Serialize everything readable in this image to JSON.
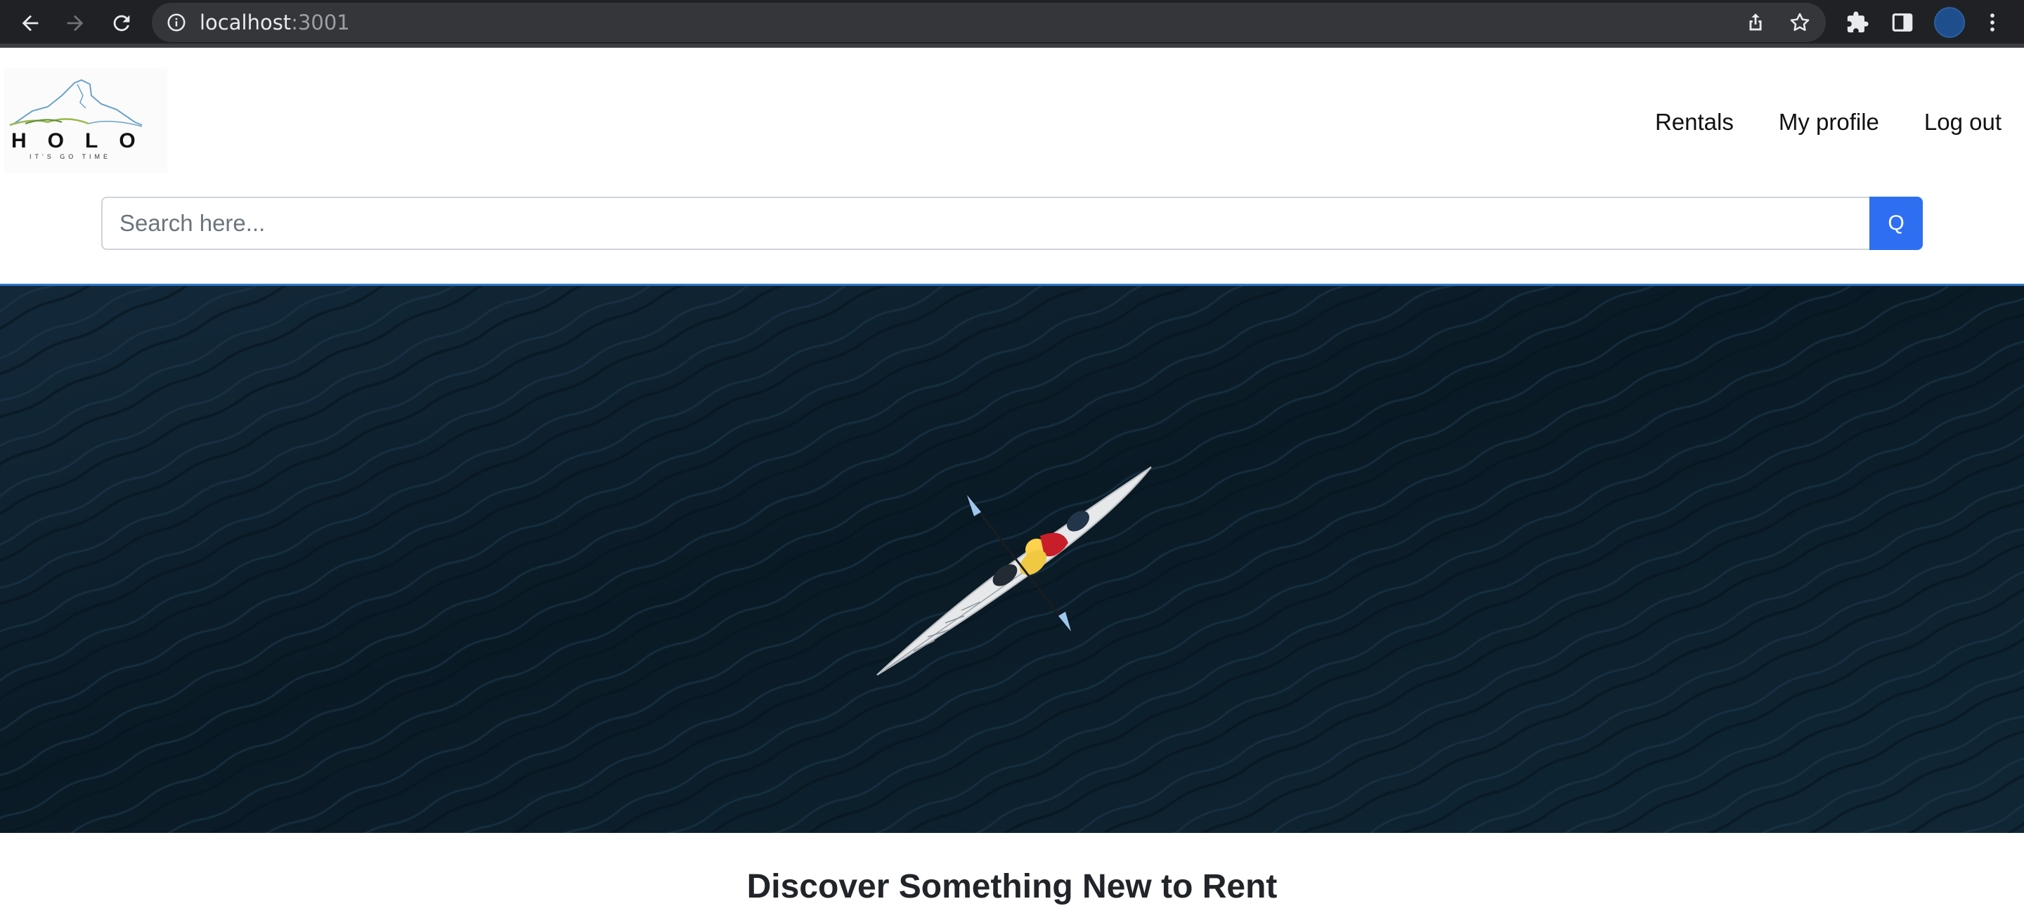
{
  "browser": {
    "url_host": "localhost",
    "url_port": ":3001",
    "icons": [
      "back-arrow-icon",
      "forward-arrow-icon",
      "reload-icon",
      "info-icon",
      "share-icon",
      "star-icon",
      "extensions-icon",
      "side-panel-icon",
      "profile-avatar",
      "menu-dots-icon"
    ]
  },
  "header": {
    "logo_text": "HOLO",
    "logo_tagline": "IT'S GO TIME",
    "nav": {
      "rentals": "Rentals",
      "profile": "My profile",
      "logout": "Log out"
    }
  },
  "search": {
    "placeholder": "Search here...",
    "value": "",
    "button_label": "Q"
  },
  "hero": {
    "image_subject": "kayak-on-dark-water"
  },
  "main": {
    "headline": "Discover Something New to Rent"
  },
  "colors": {
    "accent": "#2e6ff2",
    "hero_water": "#0c1e2b",
    "chrome_bg": "#202124"
  }
}
